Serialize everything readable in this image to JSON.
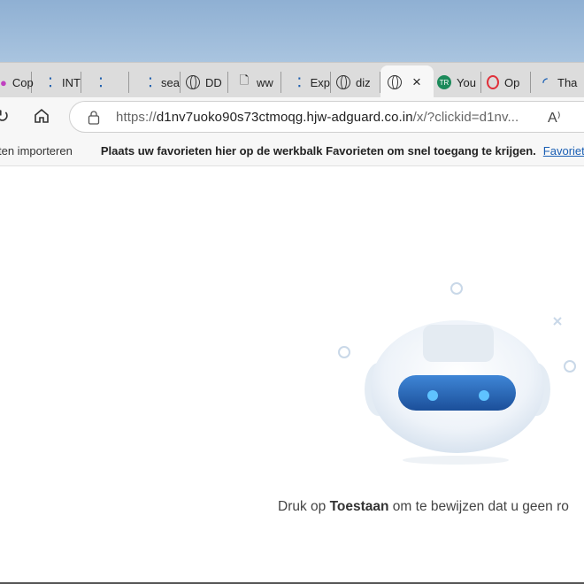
{
  "tabs": [
    {
      "label": "Cop",
      "icon": "copilot-icon"
    },
    {
      "label": "INT",
      "icon": "dots-icon"
    },
    {
      "label": "",
      "icon": "dots-icon"
    },
    {
      "label": "sea",
      "icon": "dots-icon"
    },
    {
      "label": "DD",
      "icon": "globe-icon"
    },
    {
      "label": "ww",
      "icon": "file-icon"
    },
    {
      "label": "Exp",
      "icon": "dots-icon"
    },
    {
      "label": "diz",
      "icon": "globe-icon"
    },
    {
      "label": "",
      "icon": "globe-icon",
      "active": true,
      "close": "×"
    },
    {
      "label": "You",
      "icon": "tr-icon"
    },
    {
      "label": "Op",
      "icon": "opera-icon"
    },
    {
      "label": "Tha",
      "icon": "arc-icon"
    }
  ],
  "toolbar": {
    "url_prefix": "https://",
    "url_host": "d1nv7uoko90s73ctmoqg.hjw-adguard.co.in",
    "url_rest": "/x/?clickid=d1nv...",
    "read_aloud": "A⁾"
  },
  "favbar": {
    "import": "ten importeren",
    "hint": "Plaats uw favorieten hier op de werkbalk Favorieten om snel toegang te krijgen.",
    "link": "Favorieten"
  },
  "main": {
    "msg_pre": "Druk op ",
    "msg_bold": "Toestaan",
    "msg_post": " om te bewijzen dat u geen ro"
  },
  "colors": {
    "accent": "#1a5fb4",
    "robot_visor": "#2a6cc0"
  }
}
